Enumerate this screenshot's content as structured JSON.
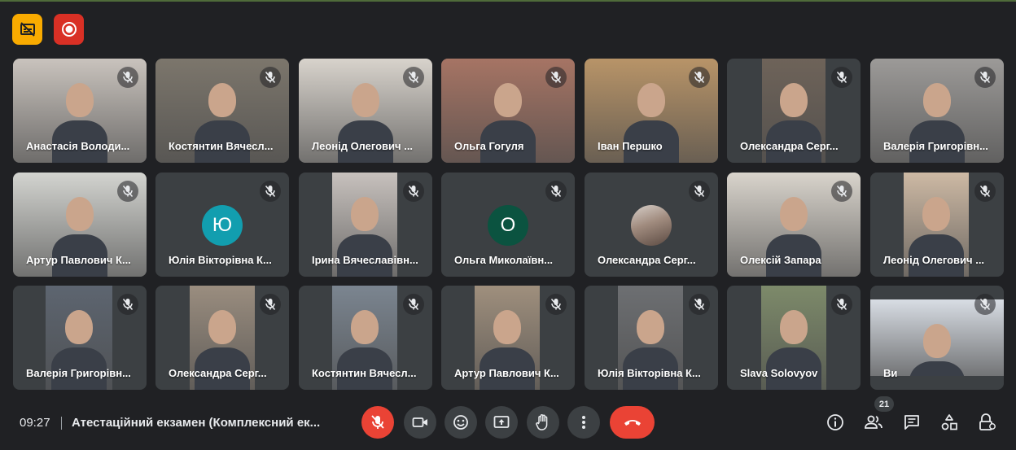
{
  "top_controls": {
    "captions_icon": "captions-off-icon",
    "record_icon": "recording-icon"
  },
  "participants": [
    {
      "name": "Анастасія Володи...",
      "type": "video",
      "bg": "#c9c3bd"
    },
    {
      "name": "Костянтин Вячесл...",
      "type": "video",
      "bg": "#7c766c"
    },
    {
      "name": "Леонід Олегович ...",
      "type": "video",
      "bg": "#d8d3cc"
    },
    {
      "name": "Ольга Гогуля",
      "type": "video",
      "bg": "#a67464"
    },
    {
      "name": "Іван Першко",
      "type": "video",
      "bg": "#b89468"
    },
    {
      "name": "Олександра Серг...",
      "type": "video",
      "bg": "#6e6359"
    },
    {
      "name": "Валерія Григорівн...",
      "type": "video",
      "bg": "#9c9a98"
    },
    {
      "name": "Артур Павлович К...",
      "type": "video",
      "bg": "#d3d4d0"
    },
    {
      "name": "Юлія Вікторівна К...",
      "type": "avatar",
      "initial": "Ю",
      "avatar_color": "#129eaf"
    },
    {
      "name": "Ірина Вячеславівн...",
      "type": "video",
      "bg": "#c7c1bd"
    },
    {
      "name": "Ольга Миколаївн...",
      "type": "avatar",
      "initial": "О",
      "avatar_color": "#0b5340"
    },
    {
      "name": "Олександра Серг...",
      "type": "photo-avatar"
    },
    {
      "name": "Олексій Запара",
      "type": "video",
      "bg": "#d9d4cc"
    },
    {
      "name": "Леонід Олегович ...",
      "type": "video",
      "bg": "#cdb9a4"
    },
    {
      "name": "Валерія Григорівн...",
      "type": "video",
      "bg": "#5d6570"
    },
    {
      "name": "Олександра Серг...",
      "type": "video",
      "bg": "#9a8d7f"
    },
    {
      "name": "Костянтин Вячесл...",
      "type": "video",
      "bg": "#7b8590"
    },
    {
      "name": "Артур Павлович К...",
      "type": "video",
      "bg": "#9f8f7d"
    },
    {
      "name": "Юлія Вікторівна К...",
      "type": "video",
      "bg": "#6d6f72"
    },
    {
      "name": "Slava Solovyov",
      "type": "video",
      "bg": "#7d8a6a"
    },
    {
      "name": "Ви",
      "type": "video",
      "bg": "#d8dde4"
    }
  ],
  "bottom_bar": {
    "time": "09:27",
    "meeting_title": "Атестаційний екзамен (Комплексний ек...",
    "people_count": "21"
  },
  "icons": {
    "mic": "mic-off-icon",
    "camera": "camera-icon",
    "reactions": "emoji-icon",
    "present": "present-screen-icon",
    "hand": "raise-hand-icon",
    "more": "more-vert-icon",
    "hangup": "hang-up-icon",
    "info": "info-icon",
    "people": "people-icon",
    "chat": "chat-icon",
    "activities": "activities-icon",
    "host_controls": "host-controls-icon"
  },
  "colors": {
    "background": "#202124",
    "tile": "#3c4043",
    "danger": "#ea4335",
    "captions": "#f9ab00"
  }
}
